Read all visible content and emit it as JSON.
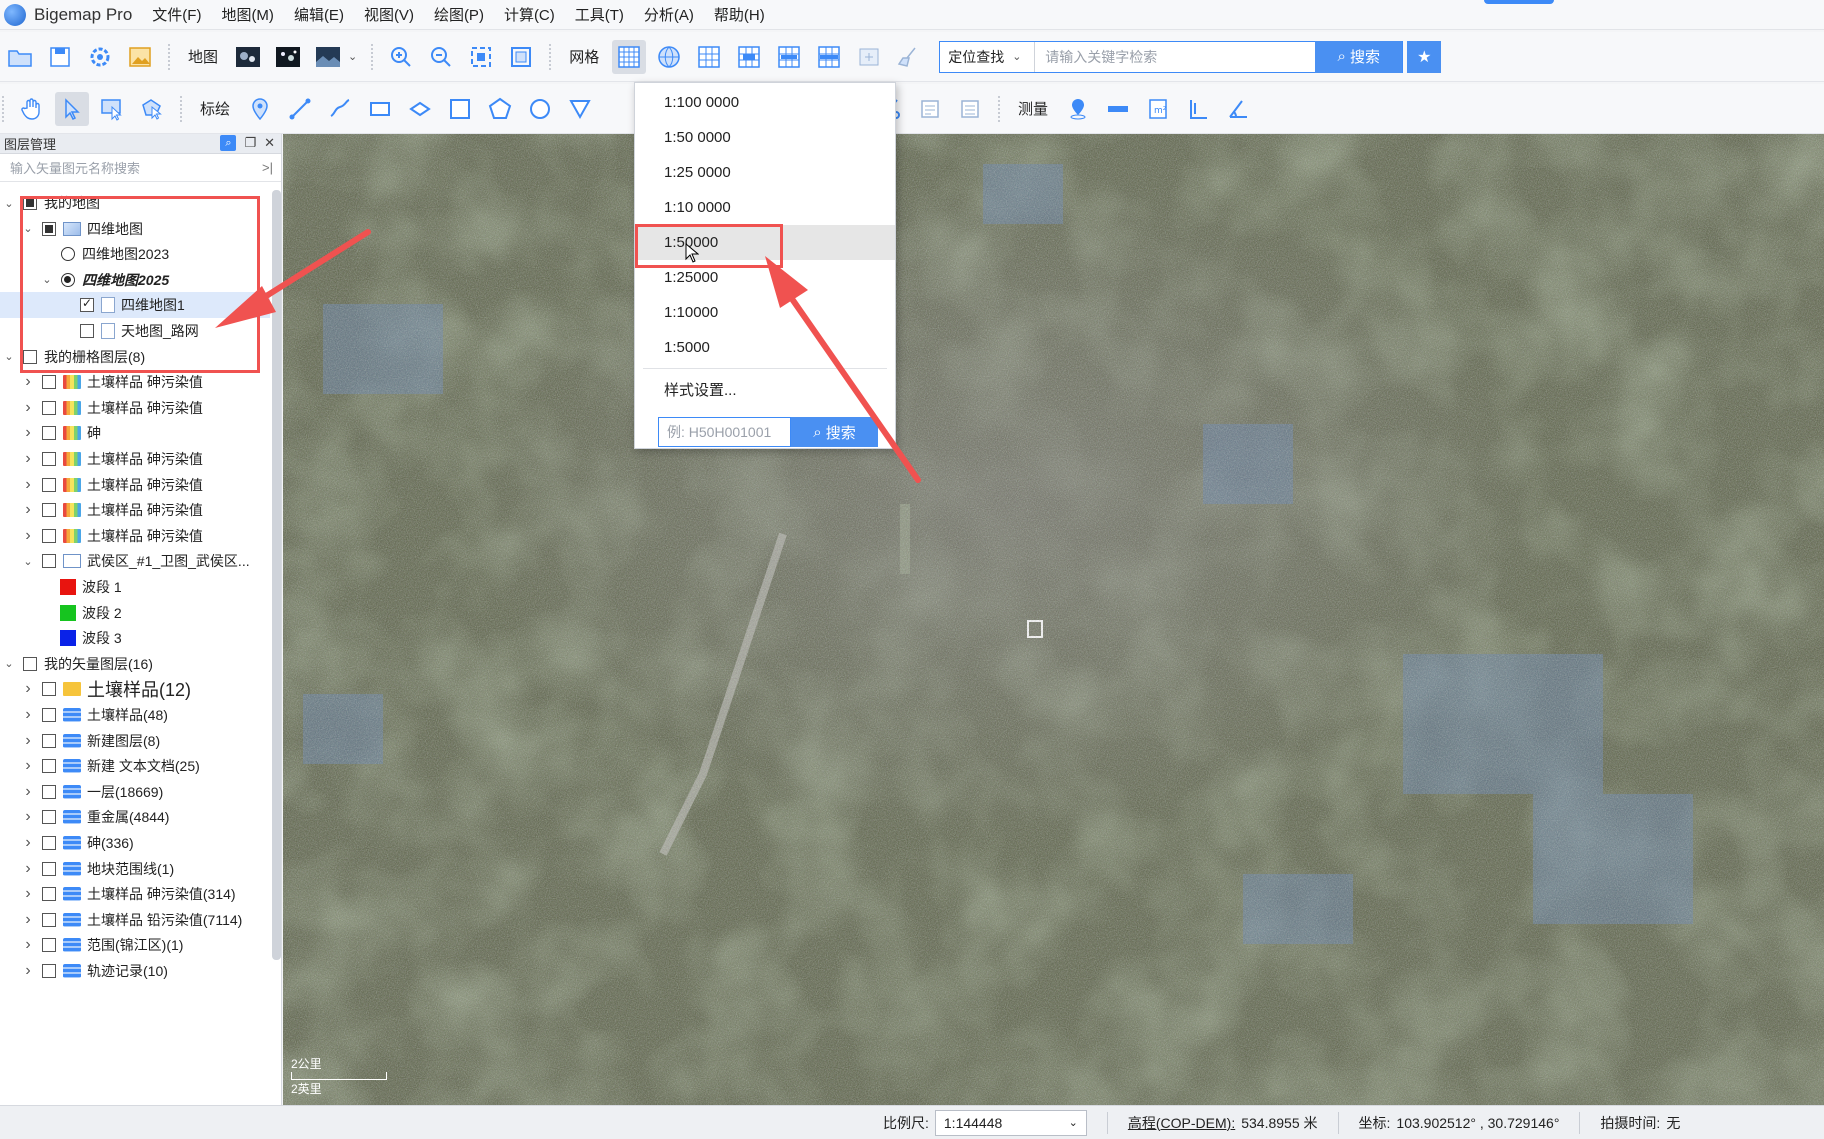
{
  "app": {
    "title": "Bigemap Pro"
  },
  "menu": [
    "文件(F)",
    "地图(M)",
    "编辑(E)",
    "视图(V)",
    "绘图(P)",
    "计算(C)",
    "工具(T)",
    "分析(A)",
    "帮助(H)"
  ],
  "toolbar1": {
    "map_label": "地图",
    "grid_label": "网格",
    "location_select": "定位查找",
    "search_placeholder": "请输入关键字检索",
    "search_button": "搜索"
  },
  "toolbar2": {
    "mark_label": "标绘",
    "measure_label": "测量"
  },
  "layer_panel": {
    "title": "图层管理",
    "search_placeholder": "输入矢量图元名称搜索",
    "tree": [
      {
        "label": "我的地图",
        "level": 0,
        "arrow": "open",
        "ctrl": "partial",
        "icon": "none"
      },
      {
        "label": "四维地图",
        "level": 1,
        "arrow": "open",
        "ctrl": "partial",
        "icon": "map"
      },
      {
        "label": "四维地图2023",
        "level": 2,
        "arrow": "none",
        "ctrl": "radio",
        "icon": "none"
      },
      {
        "label": "四维地图2025",
        "level": 2,
        "arrow": "open",
        "ctrl": "radio-on",
        "icon": "none",
        "style": "bold-italic"
      },
      {
        "label": "四维地图1",
        "level": 3,
        "arrow": "none",
        "ctrl": "checked",
        "icon": "page",
        "selected": true
      },
      {
        "label": "天地图_路网",
        "level": 3,
        "arrow": "none",
        "ctrl": "box",
        "icon": "page"
      },
      {
        "label": "我的栅格图层(8)",
        "level": 0,
        "arrow": "open",
        "ctrl": "box",
        "icon": "none"
      },
      {
        "label": "土壤样品 砷污染值",
        "level": 1,
        "arrow": "closed",
        "ctrl": "box",
        "icon": "raster"
      },
      {
        "label": "土壤样品 砷污染值",
        "level": 1,
        "arrow": "closed",
        "ctrl": "box",
        "icon": "raster"
      },
      {
        "label": "砷",
        "level": 1,
        "arrow": "closed",
        "ctrl": "box",
        "icon": "raster"
      },
      {
        "label": "土壤样品 砷污染值",
        "level": 1,
        "arrow": "closed",
        "ctrl": "box",
        "icon": "raster"
      },
      {
        "label": "土壤样品 砷污染值",
        "level": 1,
        "arrow": "closed",
        "ctrl": "box",
        "icon": "raster"
      },
      {
        "label": "土壤样品 砷污染值",
        "level": 1,
        "arrow": "closed",
        "ctrl": "box",
        "icon": "raster"
      },
      {
        "label": "土壤样品 砷污染值",
        "level": 1,
        "arrow": "closed",
        "ctrl": "box",
        "icon": "raster"
      },
      {
        "label": "武侯区_#1_卫图_武侯区...",
        "level": 1,
        "arrow": "open",
        "ctrl": "box",
        "icon": "img"
      },
      {
        "label": "波段 1",
        "level": 2,
        "arrow": "none",
        "ctrl": "band",
        "icon": "none",
        "color": "#e8140f"
      },
      {
        "label": "波段 2",
        "level": 2,
        "arrow": "none",
        "ctrl": "band",
        "icon": "none",
        "color": "#16c41f"
      },
      {
        "label": "波段 3",
        "level": 2,
        "arrow": "none",
        "ctrl": "band",
        "icon": "none",
        "color": "#0a22e8"
      },
      {
        "label": "我的矢量图层(16)",
        "level": 0,
        "arrow": "open",
        "ctrl": "box",
        "icon": "none"
      },
      {
        "label": "土壤样品(12)",
        "level": 1,
        "arrow": "closed",
        "ctrl": "box",
        "icon": "folder",
        "style": "big"
      },
      {
        "label": "土壤样品(48)",
        "level": 1,
        "arrow": "closed",
        "ctrl": "box",
        "icon": "stack"
      },
      {
        "label": "新建图层(8)",
        "level": 1,
        "arrow": "closed",
        "ctrl": "box",
        "icon": "stack"
      },
      {
        "label": "新建 文本文档(25)",
        "level": 1,
        "arrow": "closed",
        "ctrl": "box",
        "icon": "stack"
      },
      {
        "label": "一层(18669)",
        "level": 1,
        "arrow": "closed",
        "ctrl": "box",
        "icon": "stack"
      },
      {
        "label": "重金属(4844)",
        "level": 1,
        "arrow": "closed",
        "ctrl": "box",
        "icon": "stack"
      },
      {
        "label": "砷(336)",
        "level": 1,
        "arrow": "closed",
        "ctrl": "box",
        "icon": "stack"
      },
      {
        "label": "地块范围线(1)",
        "level": 1,
        "arrow": "closed",
        "ctrl": "box",
        "icon": "stack"
      },
      {
        "label": "土壤样品 砷污染值(314)",
        "level": 1,
        "arrow": "closed",
        "ctrl": "box",
        "icon": "stack"
      },
      {
        "label": "土壤样品 铅污染值(7114)",
        "level": 1,
        "arrow": "closed",
        "ctrl": "box",
        "icon": "stack"
      },
      {
        "label": "范围(锦江区)(1)",
        "level": 1,
        "arrow": "closed",
        "ctrl": "box",
        "icon": "stack"
      },
      {
        "label": "轨迹记录(10)",
        "level": 1,
        "arrow": "closed",
        "ctrl": "box",
        "icon": "stack"
      }
    ]
  },
  "scale_dropdown": {
    "items": [
      "1:100 0000",
      "1:50 0000",
      "1:25 0000",
      "1:10 0000",
      "1:50000",
      "1:25000",
      "1:10000",
      "1:5000"
    ],
    "hovered_index": 4,
    "style_settings": "样式设置...",
    "search_placeholder": "例: H50H001001",
    "search_button": "搜索"
  },
  "map": {
    "scale_bar_km": "2公里",
    "scale_bar_mi": "2英里"
  },
  "statusbar": {
    "scale_label": "比例尺:",
    "scale_value": "1:144448",
    "elevation_label": "高程(COP-DEM):",
    "elevation_value": "534.8955 米",
    "coord_label": "坐标:",
    "coord_value": "103.902512° , 30.729146°",
    "capture_time_label": "拍摄时间:",
    "capture_time_value": "无"
  },
  "colors": {
    "accent": "#4a90f2",
    "annotation": "#f05250",
    "map_base": "#5a6146"
  }
}
